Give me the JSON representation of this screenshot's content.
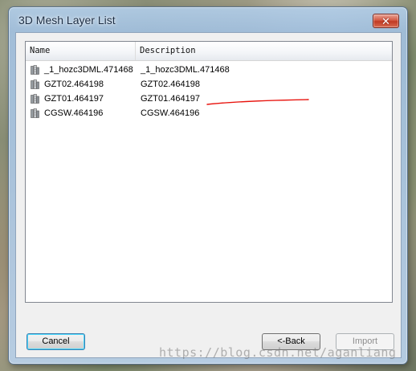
{
  "window": {
    "title": "3D Mesh Layer List",
    "close_glyph": "✕"
  },
  "list": {
    "columns": [
      "Name",
      "Description"
    ],
    "rows": [
      {
        "name": "_1_hozc3DML.471468",
        "description": "_1_hozc3DML.471468",
        "icon": "mesh-layer-icon"
      },
      {
        "name": "GZT02.464198",
        "description": "GZT02.464198",
        "icon": "mesh-layer-icon"
      },
      {
        "name": "GZT01.464197",
        "description": "GZT01.464197",
        "icon": "mesh-layer-icon"
      },
      {
        "name": "CGSW.464196",
        "description": "CGSW.464196",
        "icon": "mesh-layer-icon"
      }
    ]
  },
  "buttons": {
    "cancel": "Cancel",
    "back": "<-Back",
    "import": "Import"
  },
  "watermark": "https://blog.csdn.net/aganliang",
  "colors": {
    "annotation_underline": "#e8120c",
    "close_button": "#c83a22"
  }
}
